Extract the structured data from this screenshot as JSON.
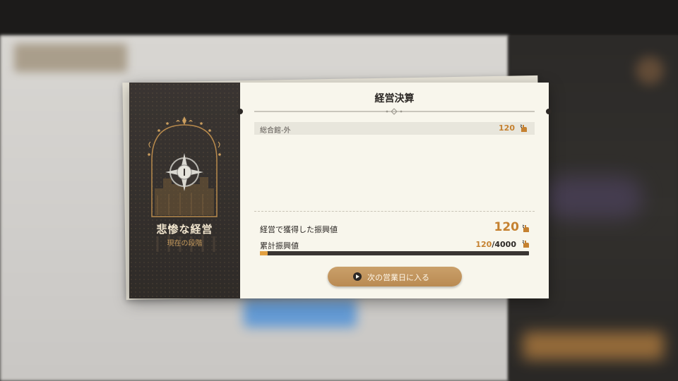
{
  "dialog": {
    "title": "経営決算",
    "stage": {
      "name": "悲惨な経営",
      "caption": "現在の段階"
    },
    "items": [
      {
        "label": "総合館-外",
        "value": "120",
        "icon": "hand-icon"
      }
    ],
    "earned": {
      "label": "経営で獲得した振興値",
      "value": "120",
      "icon": "hand-icon"
    },
    "cumulative": {
      "label": "累計振興値",
      "current": "120",
      "separator": "/",
      "target": "4000",
      "progress": 0.03,
      "icon": "hand-icon"
    },
    "next_button": {
      "label": "次の営業日に入る",
      "icon": "play-icon"
    }
  },
  "colors": {
    "accent": "#c58130",
    "progress": "#e3a040",
    "panel_dark": "#332f2c",
    "panel_light": "#f8f6ec",
    "button": "#c09660"
  }
}
